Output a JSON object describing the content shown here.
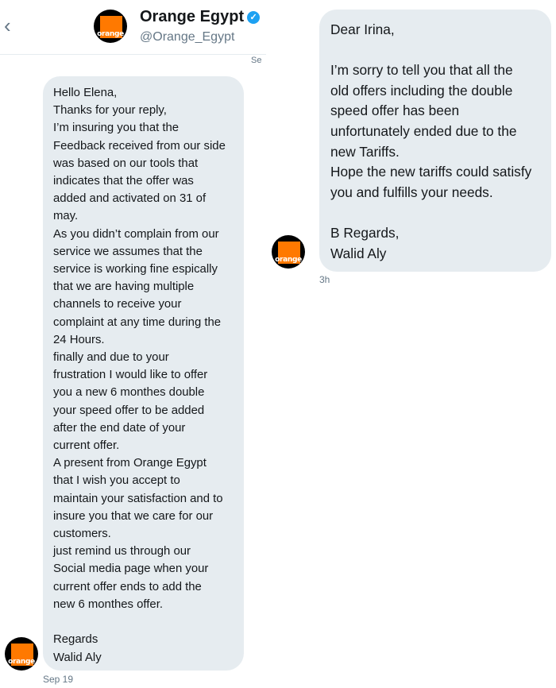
{
  "header": {
    "back_icon": "chevron-left-icon",
    "account_name": "Orange Egypt",
    "verified_icon": "verified-badge-icon",
    "handle": "@Orange_Egypt",
    "avatar_text": "orange",
    "date_fragment": "Se"
  },
  "conversation": {
    "left_message": {
      "text": "Hello Elena,\nThanks for your reply,\nI’m insuring you that the\nFeedback received from our side\nwas based on our tools that\nindicates that the offer was\nadded and activated on 31 of\nmay.\nAs you didn’t complain from our\nservice we assumes that the\nservice is working fine espically\nthat we are having multiple\nchannels to receive your\ncomplaint at any time during the\n24 Hours.\nfinally and due to your\nfrustration I would like to offer\nyou a new 6 monthes double\nyour speed offer to be added\nafter the end date of your\ncurrent offer.\nA present from Orange Egypt\nthat I wish you accept to\nmaintain your satisfaction and to\ninsure you that we care for our\ncustomers.\njust remind us through our\nSocial media page when your\ncurrent offer ends to add the\nnew 6 monthes offer.\n\nRegards\nWalid Aly",
      "timestamp": "Sep 19",
      "avatar_text": "orange"
    },
    "right_message": {
      "text": "Dear Irina,\n\nI’m sorry to tell you that all the\nold offers including the double\nspeed offer has been\nunfortunately ended due to the\nnew Tariffs.\nHope the new tariffs could satisfy\nyou and fulfills your needs.\n\nB Regards,\nWalid Aly",
      "timestamp": "3h",
      "avatar_text": "orange"
    }
  },
  "colors": {
    "bubble": "#e6ecf0",
    "brand_orange": "#ff7900",
    "verified_blue": "#1da1f2",
    "muted_text": "#657786"
  }
}
